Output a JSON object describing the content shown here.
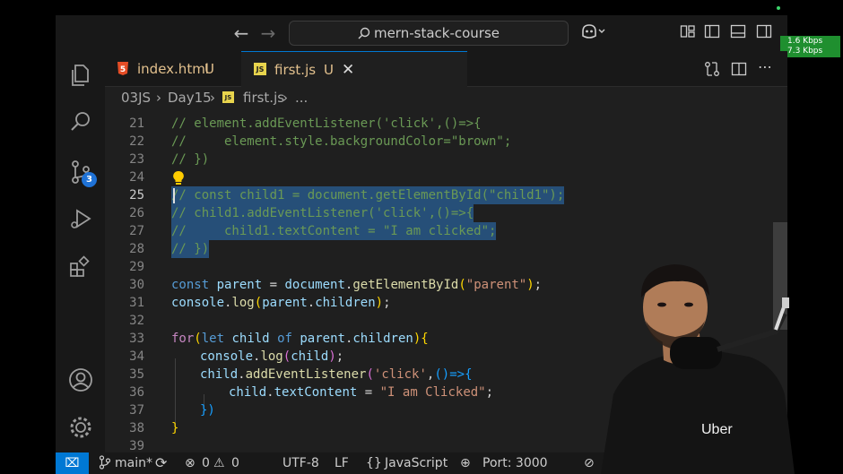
{
  "titlebar": {
    "search_text": "mern-stack-course",
    "back_icon": "arrow-left-icon",
    "forward_icon": "arrow-right-icon"
  },
  "network": {
    "down": "1.6 Kbps",
    "up": "7.3 Kbps"
  },
  "activity": {
    "source_control_badge": "3"
  },
  "tabs": [
    {
      "label": "index.html",
      "status": "U"
    },
    {
      "label": "first.js",
      "status": "U"
    }
  ],
  "breadcrumb": {
    "folder1": "03JS",
    "folder2": "Day15",
    "file": "first.js",
    "more": "..."
  },
  "code": {
    "l21": {
      "num": "21",
      "text": "// element.addEventListener('click',()=>{"
    },
    "l22": {
      "num": "22",
      "text": "//     element.style.backgroundColor=\"brown\";"
    },
    "l23": {
      "num": "23",
      "text": "// })"
    },
    "l24": {
      "num": "24"
    },
    "l25": {
      "num": "25",
      "text": "// const child1 = document.getElementById(\"child1\");"
    },
    "l26": {
      "num": "26",
      "text": "// child1.addEventListener('click',()=>{"
    },
    "l27": {
      "num": "27",
      "text": "//     child1.textContent = \"I am clicked\";"
    },
    "l28": {
      "num": "28",
      "text": "// })"
    },
    "l29": {
      "num": "29"
    },
    "l30": {
      "num": "30",
      "kw": "const",
      "var": "parent",
      "eq": " = ",
      "obj": "document",
      "dot": ".",
      "fn": "getElementById",
      "str": "\"parent\"",
      "end": ";"
    },
    "l31": {
      "num": "31",
      "obj": "console",
      "fn": "log",
      "arg1": "parent",
      "arg2": "children",
      "end": ";"
    },
    "l32": {
      "num": "32"
    },
    "l33": {
      "num": "33",
      "kw": "for",
      "kw2": "let",
      "var": "child",
      "of": "of",
      "obj": "parent",
      "prop": "children"
    },
    "l34": {
      "num": "34",
      "obj": "console",
      "fn": "log",
      "arg": "child",
      "end": ";"
    },
    "l35": {
      "num": "35",
      "obj": "child",
      "fn": "addEventListener",
      "str": "'click'",
      "arrow": "()=>"
    },
    "l36": {
      "num": "36",
      "obj": "child",
      "prop": "textContent",
      "eq": " = ",
      "str": "\"I am Clicked\"",
      "end": ";"
    },
    "l37": {
      "num": "37",
      "text": "})"
    },
    "l38": {
      "num": "38",
      "text": "}"
    },
    "l39": {
      "num": "39"
    }
  },
  "status": {
    "branch": "main*",
    "errors": "0",
    "warnings": "0",
    "encoding": "UTF-8",
    "eol": "LF",
    "language": "JavaScript",
    "port": "Port: 3000"
  },
  "webcam": {
    "shirt_logo": "Uber"
  },
  "colors": {
    "accent": "#0078d4",
    "selection": "#264f78",
    "badge": "#1f72d6"
  }
}
